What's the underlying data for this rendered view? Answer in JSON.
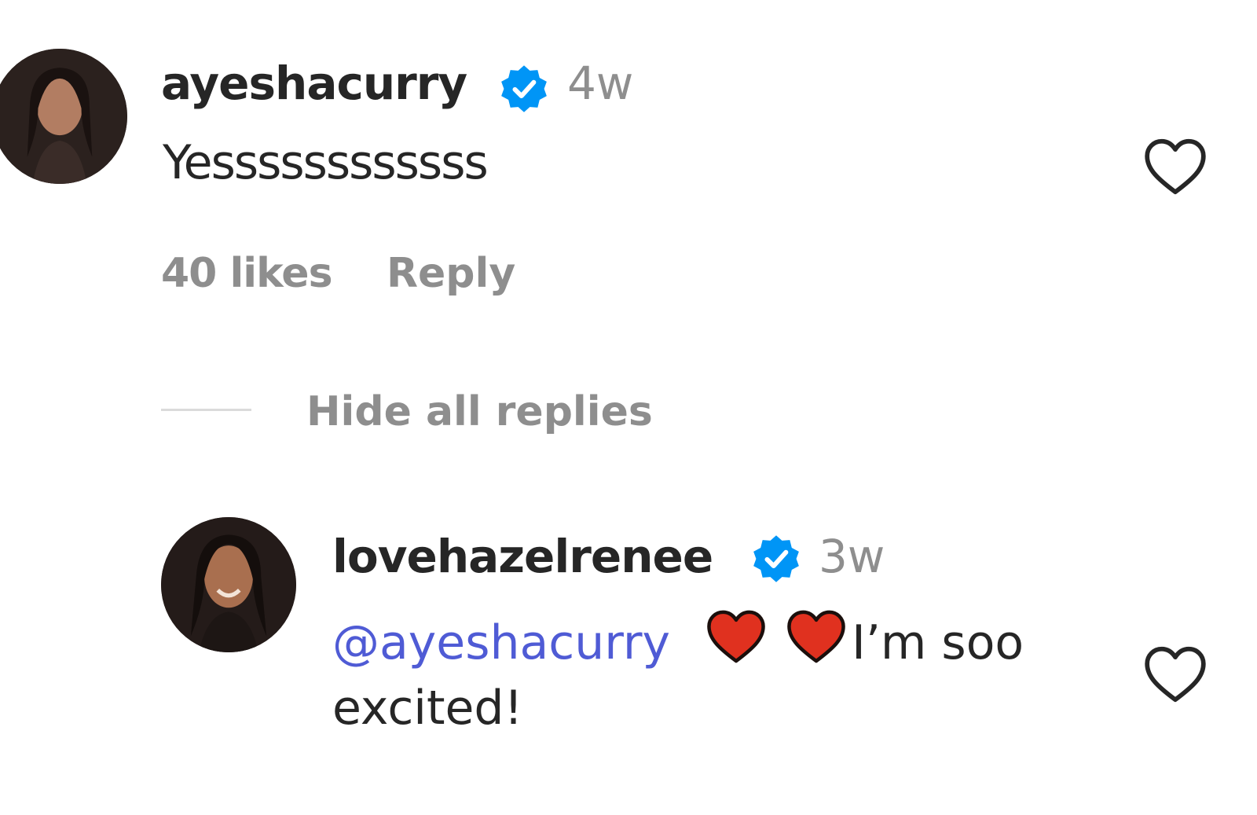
{
  "comment": {
    "username": "ayeshacurry",
    "time": "4w",
    "text": "Yessssssssssss",
    "likes": "40 likes",
    "reply_label": "Reply",
    "hide_replies_label": "Hide all replies"
  },
  "reply": {
    "username": "lovehazelrenee",
    "time": "3w",
    "mention": "@ayeshacurry",
    "text_after_hearts": "I’m soo",
    "text_line2": "excited!"
  },
  "icons": {
    "verified": "verified-badge-icon",
    "like": "heart-outline-icon",
    "emoji": "red-heart-emoji-icon"
  },
  "colors": {
    "verified_blue": "#0095f6",
    "mention": "#4f5bd5",
    "heart_red": "#e0311f",
    "muted": "#8e8e8e"
  }
}
